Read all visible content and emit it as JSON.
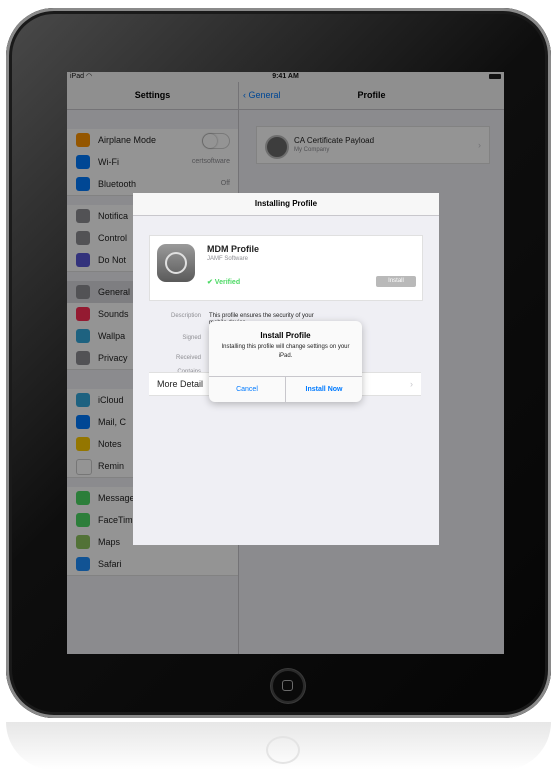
{
  "status_bar": {
    "device": "iPad",
    "wifi_icon": "wifi-icon",
    "time": "9:41 AM"
  },
  "settings": {
    "title": "Settings",
    "rows": [
      {
        "label": "Airplane Mode",
        "value": "",
        "color": "#ff9500",
        "toggle": true
      },
      {
        "label": "Wi-Fi",
        "value": "certsoftware",
        "color": "#007aff",
        "toggle": false
      },
      {
        "label": "Bluetooth",
        "value": "Off",
        "color": "#007aff",
        "toggle": false
      },
      {
        "label": "Notifica",
        "value": "",
        "color": "#8e8e93",
        "toggle": false
      },
      {
        "label": "Control",
        "value": "",
        "color": "#8e8e93",
        "toggle": false
      },
      {
        "label": "Do Not",
        "value": "",
        "color": "#5856d6",
        "toggle": false
      },
      {
        "label": "General",
        "value": "",
        "color": "#8e8e93",
        "toggle": false
      },
      {
        "label": "Sounds",
        "value": "",
        "color": "#ff2d55",
        "toggle": false
      },
      {
        "label": "Wallpa",
        "value": "",
        "color": "#34aadc",
        "toggle": false
      },
      {
        "label": "Privacy",
        "value": "",
        "color": "#8e8e93",
        "toggle": false
      },
      {
        "label": "iCloud",
        "value": "",
        "color": "#34aadc",
        "toggle": false
      },
      {
        "label": "Mail, C",
        "value": "",
        "color": "#007aff",
        "toggle": false
      },
      {
        "label": "Notes",
        "value": "",
        "color": "#ffcc00",
        "toggle": false
      },
      {
        "label": "Remin",
        "value": "",
        "color": "#ffffff",
        "toggle": false
      },
      {
        "label": "Messages",
        "value": "",
        "color": "#4cd964",
        "toggle": false
      },
      {
        "label": "FaceTime",
        "value": "",
        "color": "#4cd964",
        "toggle": false
      },
      {
        "label": "Maps",
        "value": "",
        "color": "#8ec460",
        "toggle": false
      },
      {
        "label": "Safari",
        "value": "",
        "color": "#1e90ff",
        "toggle": false
      }
    ]
  },
  "profile_pane": {
    "back_label": "General",
    "title": "Profile",
    "card": {
      "title": "CA Certificate Payload",
      "subtitle": "My Company"
    }
  },
  "installing_sheet": {
    "title": "Installing Profile",
    "profile_name": "MDM Profile",
    "company": "JAMF Software",
    "verified": "✔ Verified",
    "install_label": "Install",
    "details": [
      {
        "label": "Description",
        "value": "This profile ensures the security of your mobile device."
      },
      {
        "label": "Signed",
        "value": ""
      },
      {
        "label": "Received",
        "value": ""
      },
      {
        "label": "Contains",
        "value": ""
      }
    ],
    "more_label": "More Detail"
  },
  "alert": {
    "title": "Install Profile",
    "message": "Installing this profile will change settings on your iPad.",
    "cancel_label": "Cancel",
    "install_now_label": "Install Now"
  }
}
